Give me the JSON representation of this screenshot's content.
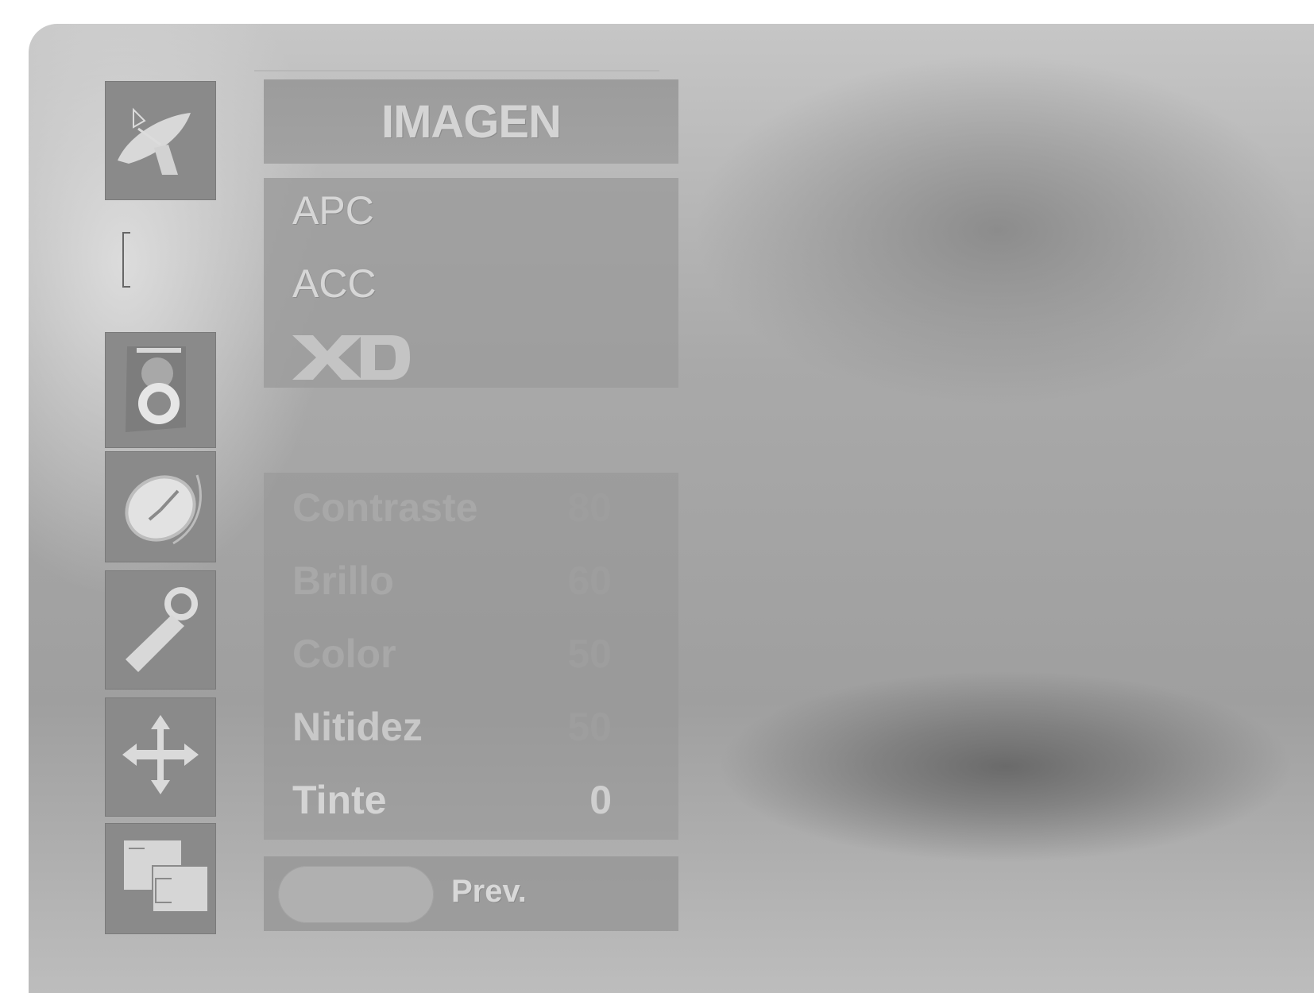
{
  "menu": {
    "title": "IMAGEN",
    "top_items": [
      {
        "label": "APC"
      },
      {
        "label": "ACC"
      }
    ],
    "xd_logo": "XD",
    "settings": [
      {
        "label": "Contraste",
        "value": "80"
      },
      {
        "label": "Brillo",
        "value": "60"
      },
      {
        "label": "Color",
        "value": "50"
      },
      {
        "label": "Nitidez",
        "value": "50"
      },
      {
        "label": "Tinte",
        "value": "0"
      }
    ],
    "footer": {
      "prev_label": "Prev."
    }
  },
  "icons": [
    "satellite-dish-icon",
    "speaker-icon",
    "clock-icon",
    "wrench-icon",
    "move-arrows-icon",
    "windows-icon"
  ],
  "colors": {
    "tile_bg": "#8a8a8a",
    "panel_bg": "#9c9c9c",
    "text_light": "#d6d6d6",
    "text_dim": "#a8a8a8"
  }
}
